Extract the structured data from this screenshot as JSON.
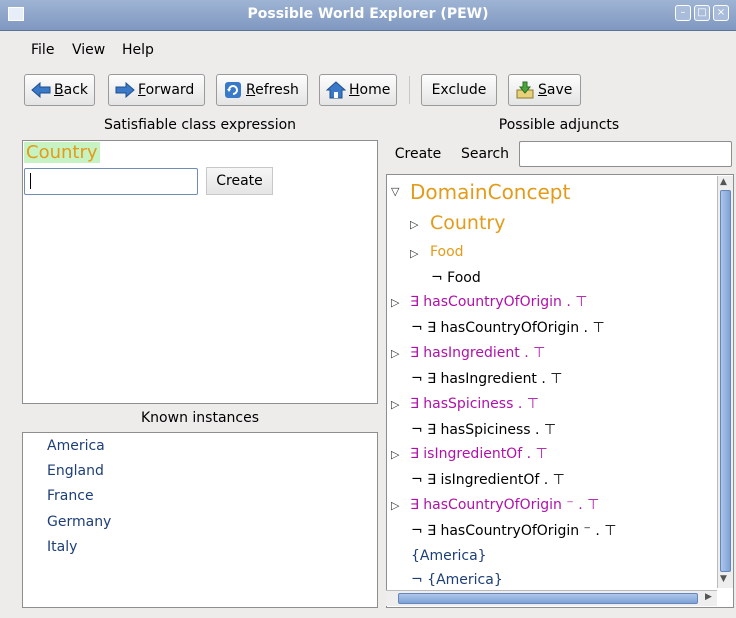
{
  "window": {
    "title": "Possible World Explorer (PEW)"
  },
  "menu": [
    "File",
    "View",
    "Help"
  ],
  "toolbar": {
    "back": {
      "underlined": "B",
      "rest": "ack"
    },
    "forward": {
      "underlined": "F",
      "rest": "orward"
    },
    "refresh": {
      "underlined": "R",
      "rest": "efresh"
    },
    "home": {
      "underlined": "H",
      "rest": "ome"
    },
    "exclude": "Exclude",
    "save": {
      "underlined": "S",
      "rest": "ave"
    }
  },
  "left": {
    "header": "Satisfiable class expression",
    "expression": "Country",
    "input_value": "",
    "create_label": "Create",
    "known_header": "Known instances",
    "instances": [
      "America",
      "England",
      "France",
      "Germany",
      "Italy"
    ]
  },
  "right": {
    "header": "Possible adjuncts",
    "create_label": "Create",
    "search_label": "Search",
    "search_value": "",
    "tree": [
      {
        "text": "DomainConcept",
        "style": "orange-xl",
        "toggle": "expanded"
      },
      {
        "text": "Country",
        "style": "orange-lg",
        "toggle": "collapsed"
      },
      {
        "text": "Food",
        "style": "orange",
        "toggle": "collapsed"
      },
      {
        "text": "¬ Food",
        "style": "black",
        "toggle": ""
      },
      {
        "text": "∃ hasCountryOfOrigin . ⊤",
        "style": "purple",
        "toggle": "collapsed"
      },
      {
        "text": "¬ ∃ hasCountryOfOrigin . ⊤",
        "style": "black",
        "toggle": ""
      },
      {
        "text": "∃ hasIngredient . ⊤",
        "style": "purple",
        "toggle": "collapsed"
      },
      {
        "text": "¬ ∃ hasIngredient . ⊤",
        "style": "black",
        "toggle": ""
      },
      {
        "text": "∃ hasSpiciness . ⊤",
        "style": "purple",
        "toggle": "collapsed"
      },
      {
        "text": "¬ ∃ hasSpiciness . ⊤",
        "style": "black",
        "toggle": ""
      },
      {
        "text": "∃ isIngredientOf . ⊤",
        "style": "purple",
        "toggle": "collapsed"
      },
      {
        "text": "¬ ∃ isIngredientOf . ⊤",
        "style": "black",
        "toggle": ""
      },
      {
        "text": "∃ hasCountryOfOrigin ⁻ . ⊤",
        "style": "purple",
        "toggle": "collapsed"
      },
      {
        "text": "¬ ∃ hasCountryOfOrigin ⁻ . ⊤",
        "style": "black",
        "toggle": ""
      },
      {
        "text": "{America}",
        "style": "blue",
        "toggle": ""
      },
      {
        "text": "¬ {America}",
        "style": "blue",
        "toggle": ""
      }
    ]
  },
  "colors": {
    "concept": "#e39b19",
    "role": "#b011a8",
    "individual": "#1d3f76"
  },
  "icons": {
    "back": "arrow-left-icon",
    "forward": "arrow-right-icon",
    "refresh": "refresh-icon",
    "home": "home-icon",
    "save": "save-icon",
    "expanded": "triangle-down-icon",
    "collapsed": "triangle-right-icon"
  }
}
